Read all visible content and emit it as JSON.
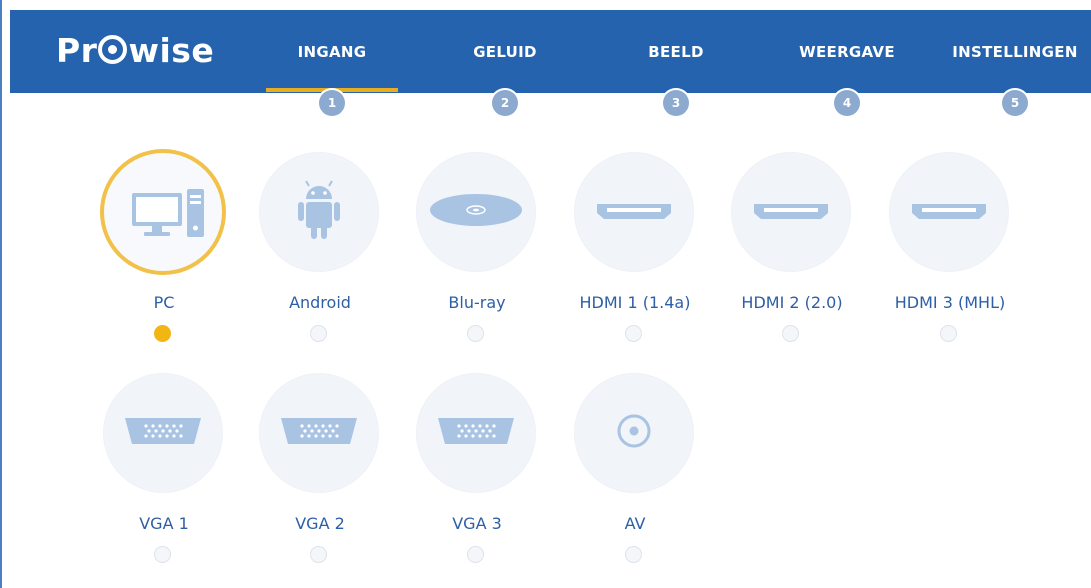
{
  "header": {
    "brand": {
      "text_before": "Pr",
      "text_after": "wise"
    },
    "steps": [
      {
        "label": "INGANG",
        "number": "1",
        "active": true
      },
      {
        "label": "GELUID",
        "number": "2",
        "active": false
      },
      {
        "label": "BEELD",
        "number": "3",
        "active": false
      },
      {
        "label": "WEERGAVE",
        "number": "4",
        "active": false
      },
      {
        "label": "INSTELLINGEN",
        "number": "5",
        "active": false
      }
    ]
  },
  "inputs": [
    {
      "label": "PC",
      "icon": "pc-icon",
      "selected": true
    },
    {
      "label": "Android",
      "icon": "android-icon",
      "selected": false
    },
    {
      "label": "Blu-ray",
      "icon": "bluray-disc-icon",
      "selected": false
    },
    {
      "label": "HDMI 1 (1.4a)",
      "icon": "hdmi-icon",
      "selected": false
    },
    {
      "label": "HDMI 2 (2.0)",
      "icon": "hdmi-icon",
      "selected": false
    },
    {
      "label": "HDMI 3 (MHL)",
      "icon": "hdmi-icon",
      "selected": false
    },
    {
      "label": "VGA 1",
      "icon": "vga-icon",
      "selected": false
    },
    {
      "label": "VGA 2",
      "icon": "vga-icon",
      "selected": false
    },
    {
      "label": "VGA 3",
      "icon": "vga-icon",
      "selected": false
    },
    {
      "label": "AV",
      "icon": "av-icon",
      "selected": false
    }
  ],
  "colors": {
    "header_bg": "#2563ae",
    "accent": "#f1b614",
    "label_text": "#2d5fa6",
    "icon_fill": "#a9c3e3"
  }
}
